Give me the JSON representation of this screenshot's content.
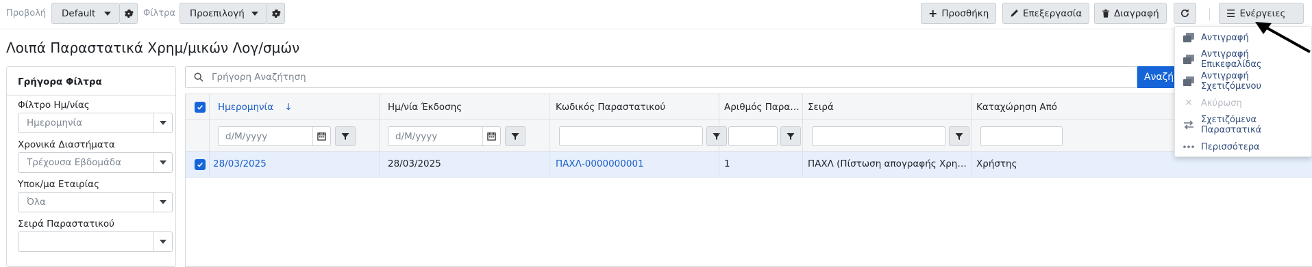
{
  "toolbar": {
    "view_label": "Προβολή",
    "view_value": "Default",
    "filter_label": "Φίλτρα",
    "filter_value": "Προεπιλογή",
    "add_label": "Προσθήκη",
    "edit_label": "Επεξεργασία",
    "delete_label": "Διαγραφή",
    "actions_label": "Ενέργειες"
  },
  "page": {
    "title": "Λοιπά Παραστατικά Χρημ/μικών Λογ/σμών"
  },
  "quick_filters": {
    "heading": "Γρήγορα Φίλτρα",
    "fields": [
      {
        "label": "Φίλτρο Ημ/νίας",
        "value": "Ημερομηνία"
      },
      {
        "label": "Χρονικά Διαστήματα",
        "value": "Τρέχουσα Εβδομάδα"
      },
      {
        "label": "Υποκ/μα Εταιρίας",
        "value": "Όλα"
      },
      {
        "label": "Σειρά Παραστατικού",
        "value": ""
      }
    ]
  },
  "search": {
    "placeholder": "Γρήγορη Αναζήτηση",
    "button_label": "Αναζήτηση"
  },
  "grid": {
    "columns": [
      "Ημερομηνία",
      "Ημ/νία Έκδοσης",
      "Κωδικός Παραστατικού",
      "Αριθμός Παραστατικού",
      "Σειρά",
      "Καταχώρηση Από"
    ],
    "sort_indicator": "↓",
    "date_placeholder": "d/M/yyyy",
    "rows": [
      {
        "date": "28/03/2025",
        "issue_date": "28/03/2025",
        "code": "ΠΑΧΛ-0000000001",
        "number": "1",
        "series": "ΠΑΧΛ (Πίστωση απογραφής Χρηματικών λογαριασμών)",
        "entered_by": "Χρήστης",
        "selected": true
      }
    ]
  },
  "actions_menu": {
    "items": [
      {
        "label": "Αντιγραφή",
        "icon": "copy-icon",
        "enabled": true
      },
      {
        "label": "Αντιγραφή Επικεφαλίδας",
        "icon": "copy-header-icon",
        "enabled": true
      },
      {
        "label": "Αντιγραφή Σχετιζόμενου",
        "icon": "copy-related-icon",
        "enabled": true
      },
      {
        "label": "Ακύρωση",
        "icon": "cancel-icon",
        "enabled": false
      },
      {
        "label": "Σχετιζόμενα Παραστατικά",
        "icon": "related-docs-icon",
        "enabled": true
      },
      {
        "label": "Περισσότερα",
        "icon": "more-icon",
        "enabled": true
      }
    ]
  },
  "colors": {
    "primary": "#1565d8",
    "link": "#1a5cc8",
    "selected_row": "#e6effb",
    "button_bg": "#e6e9ec"
  }
}
